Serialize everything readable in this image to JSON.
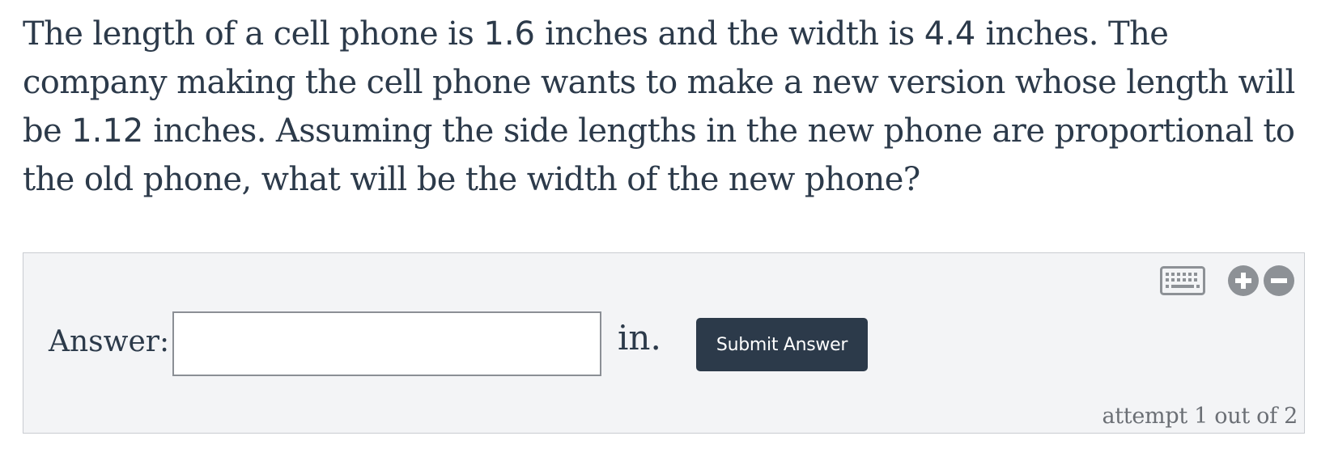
{
  "question": {
    "part1": "The length of a cell phone is ",
    "length_old": "1.6",
    "part2": " inches and the width is ",
    "width_old": "4.4",
    "part3": " inches. The company making the cell phone wants to make a new version whose length will be ",
    "length_new": "1.12",
    "part4": " inches. Assuming the side lengths in the new phone are proportional to the old phone, what will be the width of the new phone?"
  },
  "answer": {
    "label": "Answer:",
    "value": "",
    "placeholder": "",
    "unit": "in.",
    "submit_label": "Submit Answer"
  },
  "toolbar": {
    "keyboard_icon": "keyboard-icon",
    "zoom_in_icon": "zoom-in-icon",
    "zoom_out_icon": "zoom-out-icon"
  },
  "attempt": {
    "text": "attempt 1 out of 2"
  },
  "colors": {
    "text": "#2c3a4a",
    "button_bg": "#2c3a4a",
    "panel_bg": "#f3f4f6",
    "icon_gray": "#8d9196",
    "muted_text": "#6b6f75"
  }
}
